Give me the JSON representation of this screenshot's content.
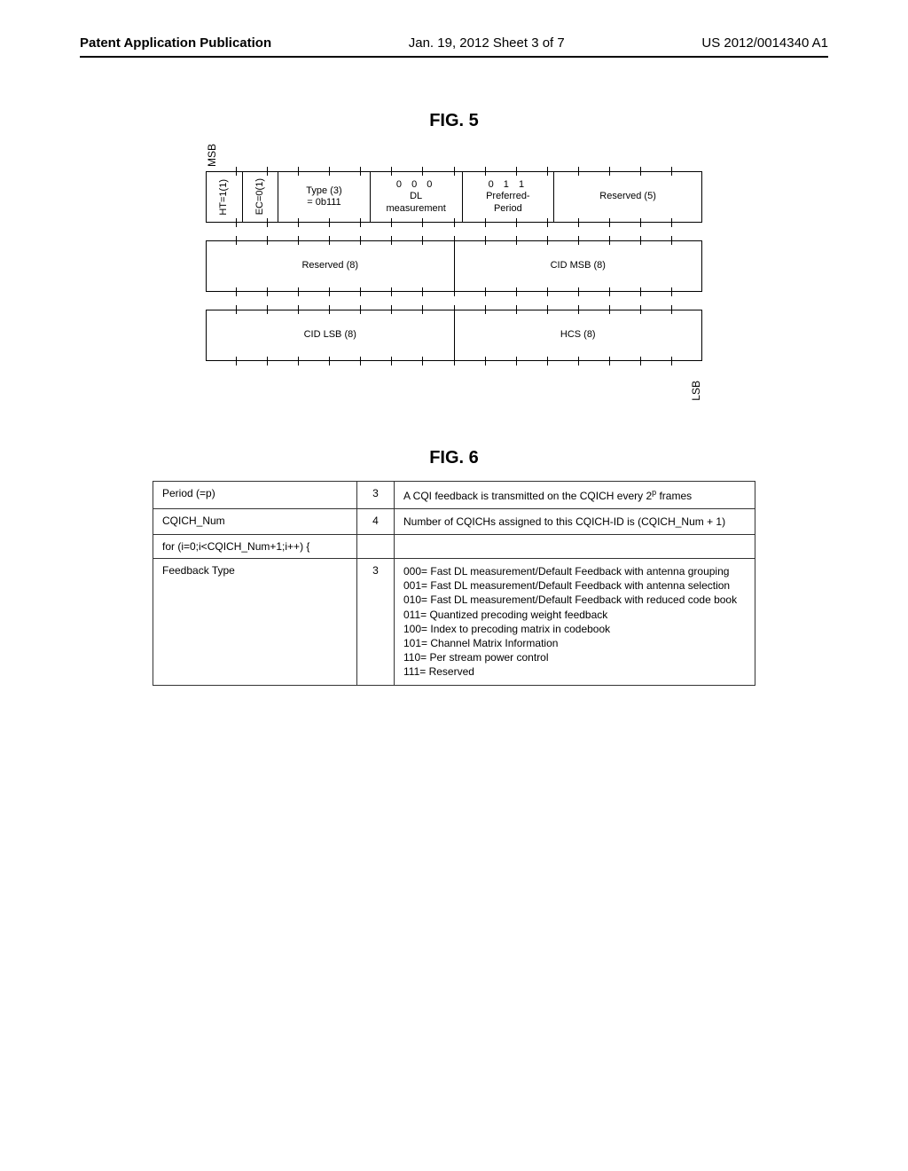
{
  "header": {
    "left": "Patent Application Publication",
    "center": "Jan. 19, 2012  Sheet 3 of 7",
    "right": "US 2012/0014340 A1"
  },
  "fig5": {
    "title": "FIG. 5",
    "msb": "MSB",
    "lsb": "LSB",
    "row1": {
      "ht": "HT=1(1)",
      "ec": "EC=0(1)",
      "type": "Type (3)\n= 0b111",
      "dl_bits": "0   0   0",
      "dl_label": "DL\nmeasurement",
      "pref_bits": "0   1   1",
      "pref_label": "Preferred-\nPeriod",
      "reserved": "Reserved (5)"
    },
    "row2": {
      "left": "Reserved (8)",
      "right": "CID MSB (8)"
    },
    "row3": {
      "left": "CID LSB (8)",
      "right": "HCS (8)"
    }
  },
  "fig6": {
    "title": "FIG. 6",
    "rows": [
      {
        "c1": "Period (=p)",
        "c2": "3",
        "c3": "A CQI feedback is transmitted on the CQICH every 2ᵖ frames"
      },
      {
        "c1": "CQICH_Num",
        "c2": "4",
        "c3": "Number of CQICHs assigned to this CQICH-ID is (CQICH_Num + 1)"
      },
      {
        "c1": "for (i=0;i<CQICH_Num+1;i++) {",
        "c2": "",
        "c3": ""
      },
      {
        "c1": "Feedback Type",
        "c2": "3",
        "c3": "000= Fast DL measurement/Default Feedback with antenna grouping\n001= Fast DL measurement/Default Feedback with antenna selection\n010= Fast DL measurement/Default Feedback with reduced code book\n011= Quantized precoding weight feedback\n100= Index to precoding matrix in codebook\n101= Channel Matrix Information\n110= Per stream power control\n111= Reserved"
      }
    ]
  }
}
